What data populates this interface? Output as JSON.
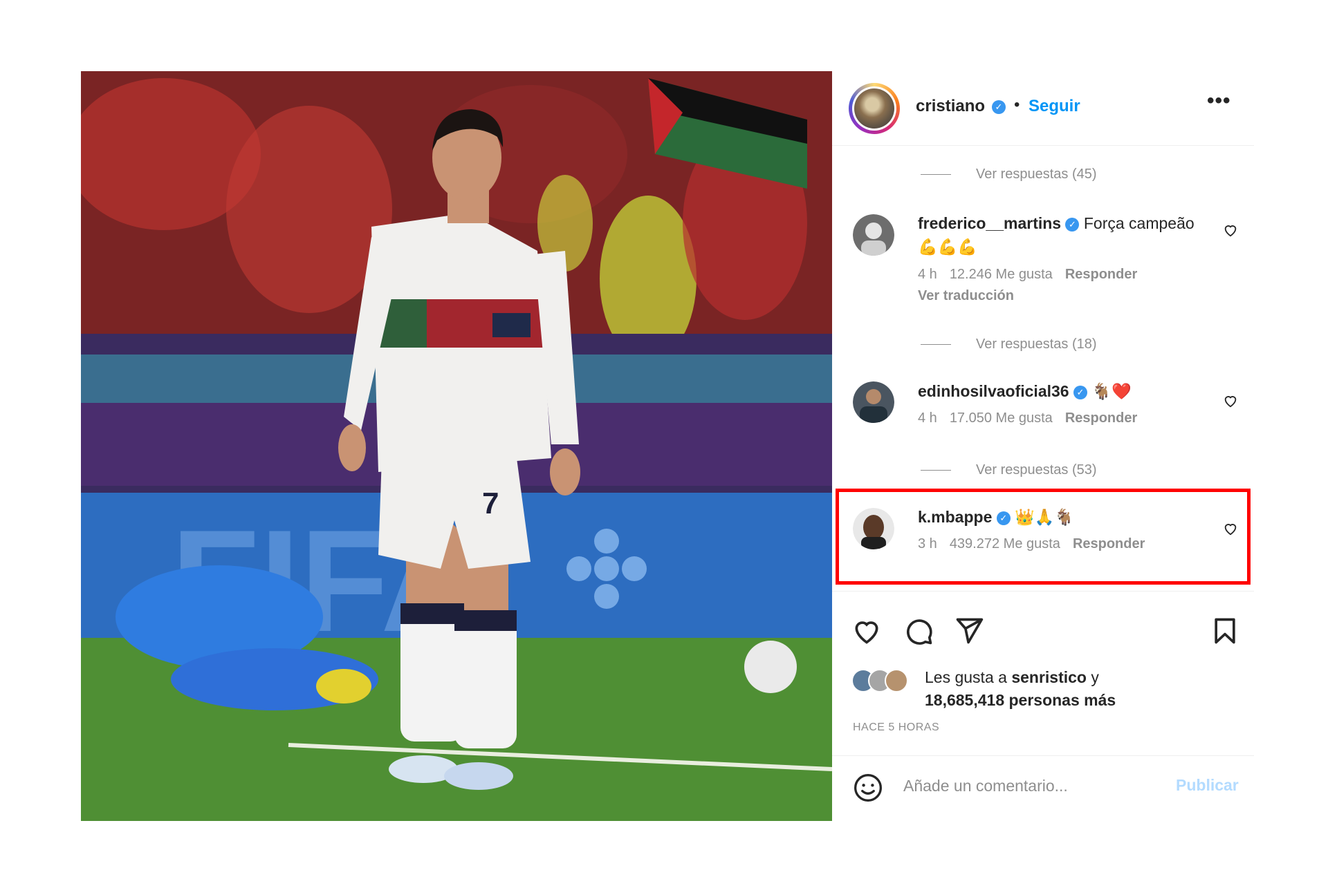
{
  "post": {
    "username": "cristiano",
    "separator": "•",
    "follow_label": "Seguir",
    "more_label": "•••"
  },
  "comments": [
    {
      "type": "replies",
      "label": "Ver respuestas (45)"
    },
    {
      "type": "comment",
      "username": "frederico__martins",
      "text": "Força campeão",
      "emoji": "💪💪💪",
      "time": "4 h",
      "likes": "12.246 Me gusta",
      "reply_label": "Responder",
      "translate_label": "Ver traducción"
    },
    {
      "type": "replies",
      "label": "Ver respuestas (18)"
    },
    {
      "type": "comment",
      "username": "edinhosilvaoficial36",
      "emoji": "🐐❤️",
      "time": "4 h",
      "likes": "17.050 Me gusta",
      "reply_label": "Responder"
    },
    {
      "type": "replies",
      "label": "Ver respuestas (53)"
    },
    {
      "type": "comment",
      "username": "k.mbappe",
      "emoji": "👑🙏🐐",
      "time": "3 h",
      "likes": "439.272 Me gusta",
      "reply_label": "Responder",
      "highlighted": true
    }
  ],
  "likes_summary": {
    "prefix": "Les gusta a",
    "user": "senristico",
    "conj": "y",
    "count": "18,685,418 personas más"
  },
  "time_ago": "HACE 5 HORAS",
  "composer": {
    "placeholder": "Añade un comentario...",
    "post_label": "Publicar"
  },
  "colors": {
    "follow": "#0095f6",
    "verified": "#3897f0",
    "highlight_border": "#ff0000",
    "muted": "#8e8e8e",
    "publish_disabled": "#b3dbff"
  }
}
